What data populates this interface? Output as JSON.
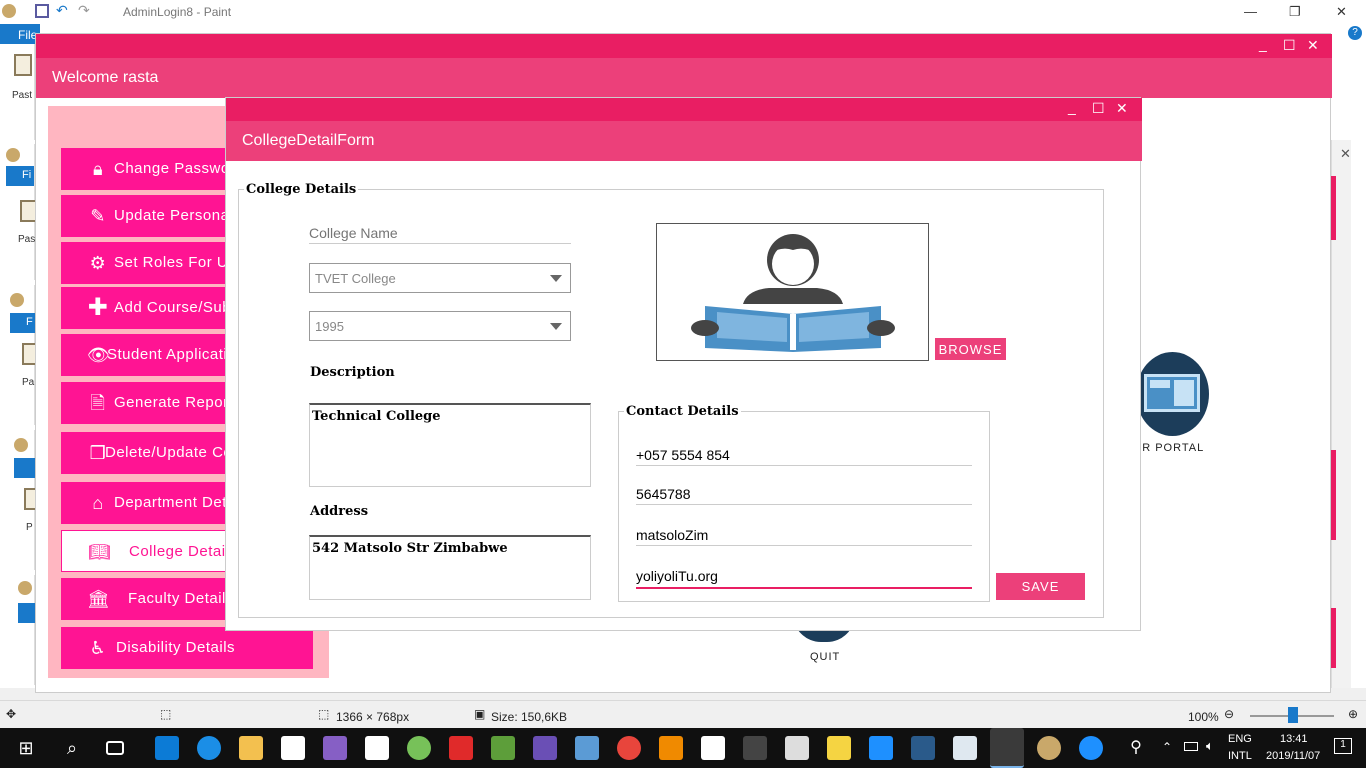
{
  "paint": {
    "title": "AdminLogin8 - Paint",
    "file_tab": "File",
    "status_dimensions": "1366 × 768px",
    "status_size": "Size: 150,6KB",
    "zoom": "100%",
    "paste_label": "Past",
    "paste_label2": "Pas",
    "paste_label3": "Pa",
    "paste_label4": "P",
    "file_short": "Fi",
    "file_short2": "F"
  },
  "welcome": {
    "title": "Welcome rasta",
    "sidebar": [
      {
        "label": "Change Password",
        "icon": "lock-icon"
      },
      {
        "label": "Update Personal Details",
        "icon": "edit-icon"
      },
      {
        "label": "Set Roles For Users",
        "icon": "gear-icon"
      },
      {
        "label": "Add Course/Subject",
        "icon": "plus-icon"
      },
      {
        "label": "Student Applications",
        "icon": "eye-icon"
      },
      {
        "label": "Generate Reports",
        "icon": "document-icon"
      },
      {
        "label": "Delete/Update Course",
        "icon": "cubes-icon"
      },
      {
        "label": "Department Details",
        "icon": "home-icon"
      },
      {
        "label": "College Details",
        "icon": "book-icon"
      },
      {
        "label": "Faculty Details",
        "icon": "bank-icon"
      },
      {
        "label": "Disability Details",
        "icon": "wheelchair-icon"
      }
    ],
    "teacher_portal": "CHER PORTAL",
    "quit": "QUIT"
  },
  "form": {
    "title": "CollegeDetailForm",
    "college_details_legend": "College Details",
    "college_name_placeholder": "College Name",
    "college_type": "TVET College",
    "year": "1995",
    "description_label": "Description",
    "description": "Technical College",
    "address_label": "Address",
    "address": "542 Matsolo Str Zimbabwe",
    "browse": "BROWSE",
    "contact_legend": "Contact Details",
    "phone": "+057 5554 854",
    "fax": "5645788",
    "contact_name": "matsoloZim",
    "website": "yoliyoliTu.org",
    "save": "SAVE"
  },
  "taskbar": {
    "lang1": "ENG",
    "lang2": "INTL",
    "time": "13:41",
    "date": "2019/11/07",
    "notifications": "1"
  },
  "colors": {
    "accent": "#e91e63",
    "header": "#ec407a",
    "sidebar_button": "#ff1493",
    "sidebar_bg": "#ffb6c1",
    "portal_icon": "#1c3d5a"
  }
}
